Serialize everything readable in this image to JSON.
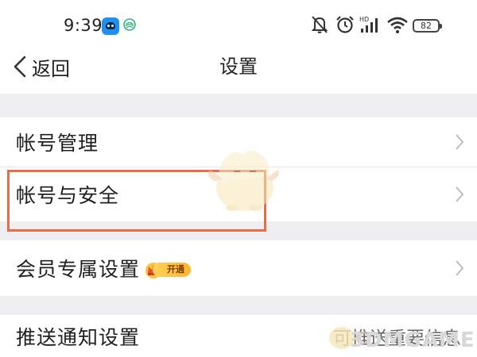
{
  "status_bar": {
    "time": "9:39",
    "battery": "82",
    "icons": [
      "app-notification-icon",
      "mobile-network-icon",
      "mute-icon",
      "alarm-icon",
      "hd-signal-icon",
      "wifi-icon",
      "battery-icon"
    ]
  },
  "nav": {
    "back_label": "返回",
    "title": "设置"
  },
  "settings": {
    "items": [
      {
        "label": "帐号管理"
      },
      {
        "label": "帐号与安全"
      },
      {
        "label": "会员专属设置",
        "badge": "开通"
      },
      {
        "label": "推送通知设置",
        "value": "可推送重要信息"
      }
    ]
  },
  "watermark": {
    "text": "3DMGAME"
  },
  "colors": {
    "highlight": "#e56d4a",
    "separator": "#efeff1",
    "badge": "#ffb52e"
  }
}
